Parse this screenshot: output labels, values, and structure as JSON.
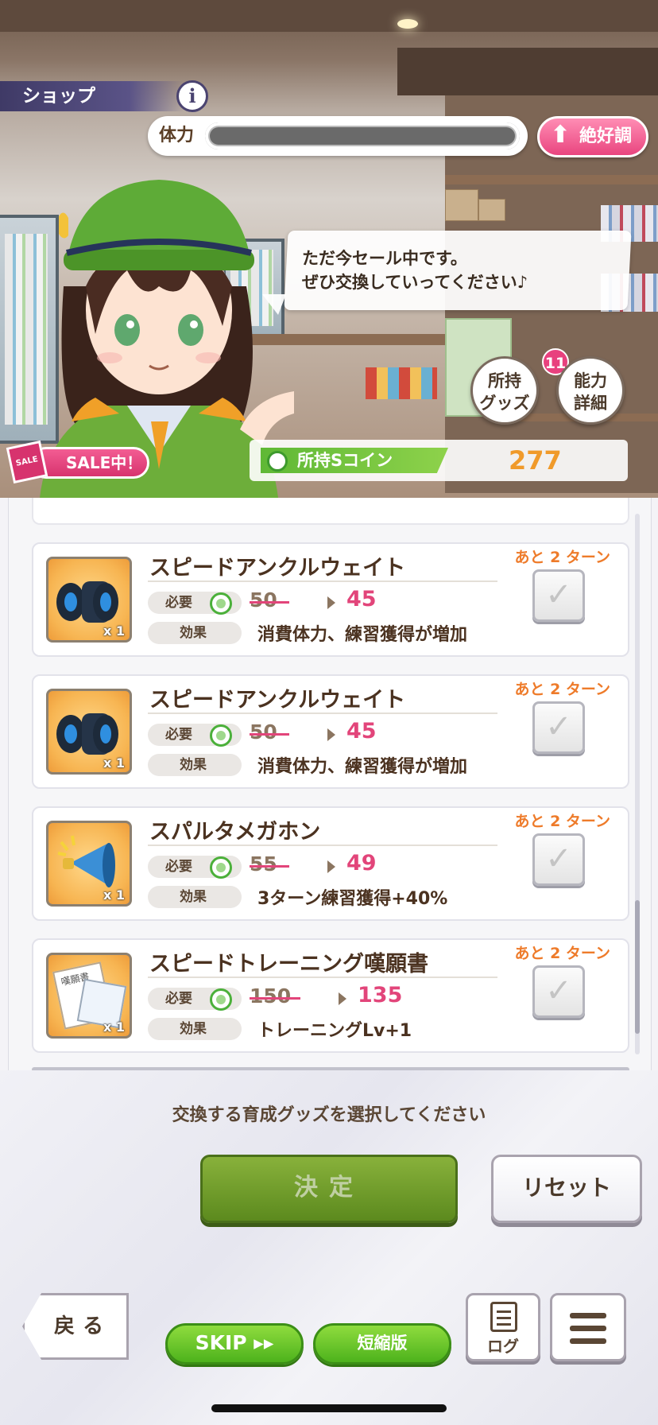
{
  "header": {
    "screen_title": "ショップ",
    "info_label": "i",
    "stamina_label": "体力",
    "stamina_level": 0,
    "mood_label": "絶好調",
    "mood_icon": "arrow-up-icon"
  },
  "dialogue": {
    "text": "ただ今セール中です。\nぜひ交換していってください♪"
  },
  "side_buttons": {
    "owned_goods": "所持\nグッズ",
    "owned_goods_count": "11",
    "ability_details": "能力\n詳細"
  },
  "coins": {
    "label": "所持Sコイン",
    "value": "277"
  },
  "sale_badge": {
    "flag_text": "SALE",
    "label": "SALE中！"
  },
  "items": [
    {
      "name": "スピードアンクルウェイト",
      "required_label": "必要",
      "old_price": "50",
      "new_price": "45",
      "effect_label": "効果",
      "effect": "消費体力、練習獲得が増加",
      "remaining": "あと 2 ターン",
      "quantity": "x 1",
      "icon": "ankle-weight-icon",
      "checked": true
    },
    {
      "name": "スピードアンクルウェイト",
      "required_label": "必要",
      "old_price": "50",
      "new_price": "45",
      "effect_label": "効果",
      "effect": "消費体力、練習獲得が増加",
      "remaining": "あと 2 ターン",
      "quantity": "x 1",
      "icon": "ankle-weight-icon",
      "checked": true
    },
    {
      "name": "スパルタメガホン",
      "required_label": "必要",
      "old_price": "55",
      "new_price": "49",
      "effect_label": "効果",
      "effect": "3ターン練習獲得+40%",
      "remaining": "あと 2 ターン",
      "quantity": "x 1",
      "icon": "megaphone-icon",
      "checked": true
    },
    {
      "name": "スピードトレーニング嘆願書",
      "required_label": "必要",
      "old_price": "150",
      "new_price": "135",
      "effect_label": "効果",
      "effect": "トレーニングLv+1",
      "remaining": "あと 2 ターン",
      "quantity": "x 1",
      "icon": "petition-icon",
      "petition_text": "嘆願書",
      "checked": true
    }
  ],
  "footer": {
    "instruction": "交換する育成グッズを選択してください",
    "confirm": "決定",
    "reset": "リセット",
    "back": "戻る",
    "skip": "SKIP ▸▸",
    "short_version": "短縮版",
    "log": "ログ"
  },
  "colors": {
    "accent_pink": "#e2457a",
    "accent_orange": "#ee7b2a",
    "coin_green": "#5fb835",
    "confirm_green": "#5c8a1e",
    "text_brown": "#4b3220"
  }
}
